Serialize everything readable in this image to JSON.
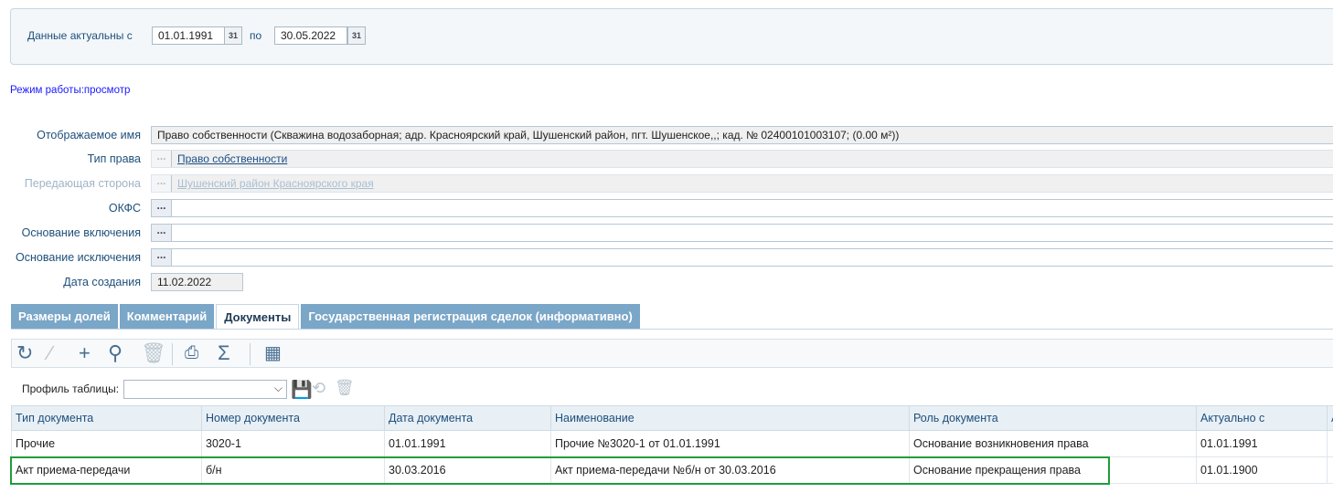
{
  "filter": {
    "label": "Данные актуальны с",
    "date_from": "01.01.1991",
    "to_label": "по",
    "date_to": "30.05.2022",
    "calendar_glyph": "31"
  },
  "mode_text": "Режим работы:просмотр",
  "form": {
    "display_name_label": "Отображаемое имя",
    "display_name_value": "Право собственности (Скважина водозаборная; адр. Красноярский край, Шушенский район, пгт. Шушенское,,; кад. № 02400101003107; (0.00 м²))",
    "right_type_label": "Тип права",
    "right_type_value": "Право собственности",
    "transferring_label": "Передающая сторона",
    "transferring_value": "Шушенский район Красноярского края",
    "okfs_label": "ОКФС",
    "inclusion_label": "Основание включения",
    "exclusion_label": "Основание исключения",
    "created_label": "Дата создания",
    "created_value": "11.02.2022",
    "dots": "..."
  },
  "tabs": [
    "Размеры долей",
    "Комментарий",
    "Документы",
    "Государственная регистрация сделок (информативно)"
  ],
  "profile": {
    "label": "Профиль таблицы:",
    "value": ""
  },
  "grid": {
    "headers": [
      "Тип документа",
      "Номер документа",
      "Дата документа",
      "Наименование",
      "Роль документа",
      "Актуально с",
      "А"
    ],
    "rows": [
      [
        "Прочие",
        "3020-1",
        "01.01.1991",
        "Прочие №3020-1 от 01.01.1991",
        "Основание возникновения права",
        "01.01.1991",
        ""
      ],
      [
        "Акт приема-передачи",
        "б/н",
        "30.03.2016",
        "Акт приема-передачи №б/н от 30.03.2016",
        "Основание прекращения права",
        "01.01.1900",
        ""
      ]
    ]
  }
}
